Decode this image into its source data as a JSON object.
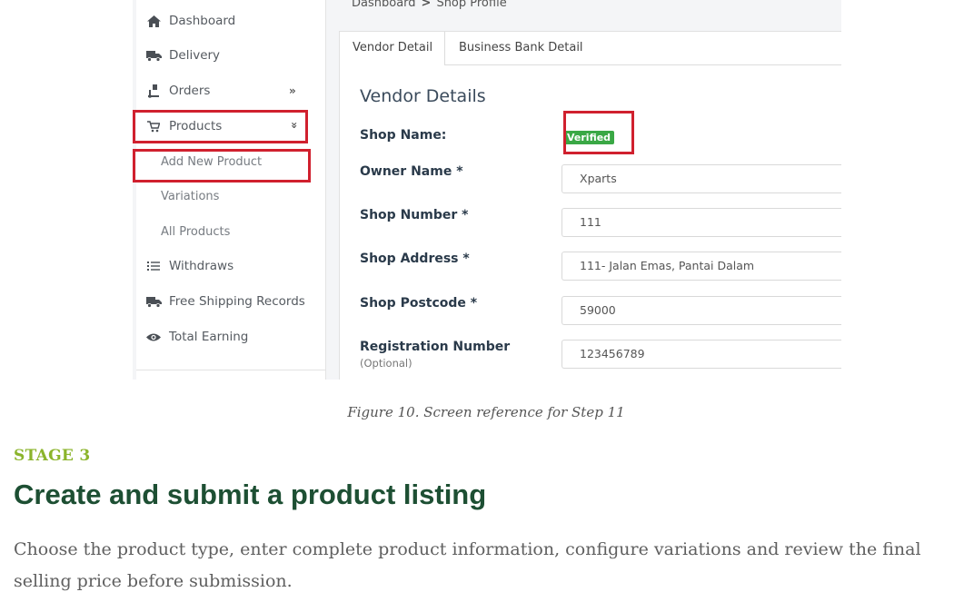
{
  "sidebar": {
    "items": [
      {
        "label": "Dashboard",
        "icon": "home-icon"
      },
      {
        "label": "Delivery",
        "icon": "truck-icon"
      },
      {
        "label": "Orders",
        "icon": "dolly-icon",
        "chevron": "»"
      },
      {
        "label": "Products",
        "icon": "cart-icon",
        "chevron": "»"
      },
      {
        "label": "Withdraws",
        "icon": "list-icon"
      },
      {
        "label": "Free Shipping Records",
        "icon": "truck-icon"
      },
      {
        "label": "Total Earning",
        "icon": "eye-icon"
      }
    ],
    "products_submenu": [
      "Add New Product",
      "Variations",
      "All Products"
    ]
  },
  "breadcrumb": {
    "home": "Dashboard",
    "separator": ">",
    "current": "Shop Profile"
  },
  "tabs": [
    "Vendor Detail",
    "Business Bank Detail"
  ],
  "vendor": {
    "title": "Vendor Details",
    "shop_name_label": "Shop Name:",
    "verified_badge": "Verified",
    "fields": [
      {
        "label": "Owner Name *",
        "value": "Xparts"
      },
      {
        "label": "Shop Number *",
        "value": "111"
      },
      {
        "label": "Shop Address *",
        "value": "111- Jalan Emas, Pantai Dalam"
      },
      {
        "label": "Shop Postcode *",
        "value": "59000"
      },
      {
        "label": "Registration Number",
        "sub": "(Optional)",
        "value": "123456789"
      }
    ]
  },
  "colors": {
    "highlight_box": "#d0202e",
    "verified_badge": "#3aa845",
    "stage_label": "#8bb42b",
    "stage_title": "#1d4f33"
  },
  "caption": "Figure 10. Screen reference for Step 11",
  "stage": {
    "label": "STAGE 3",
    "title": "Create and submit a product listing",
    "body": "Choose the product type, enter complete product information, configure variations and review the final selling price before submission."
  }
}
